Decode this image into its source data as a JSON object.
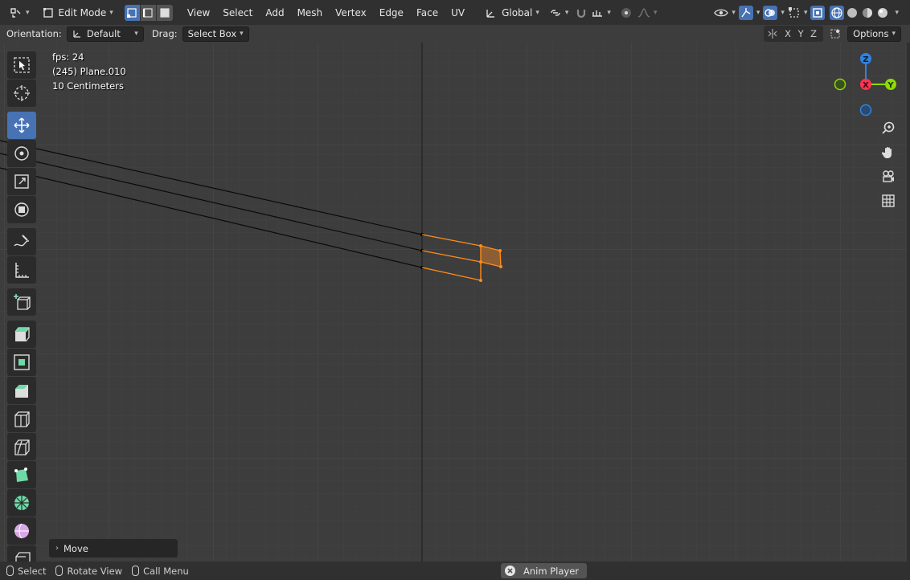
{
  "header": {
    "mode": "Edit Mode",
    "menus": [
      "View",
      "Select",
      "Add",
      "Mesh",
      "Vertex",
      "Edge",
      "Face",
      "UV"
    ],
    "transform_orientation": "Global"
  },
  "tool_options": {
    "orientation_label": "Orientation:",
    "orientation_value": "Default",
    "drag_label": "Drag:",
    "drag_value": "Select Box",
    "axis_x": "X",
    "axis_y": "Y",
    "axis_z": "Z",
    "options_label": "Options"
  },
  "viewport": {
    "fps": "fps: 24",
    "object": "(245) Plane.010",
    "scale": "10 Centimeters"
  },
  "gizmo": {
    "z": "Z",
    "x": "X",
    "y": "Y"
  },
  "last_operator": "Move",
  "statusbar": {
    "select": "Select",
    "rotate": "Rotate View",
    "call_menu": "Call Menu",
    "anim_player": "Anim Player"
  },
  "colors": {
    "accent": "#4772b3",
    "selection": "#ff8c1a",
    "axis_x": "#ff3352",
    "axis_y": "#8bdc00",
    "axis_z": "#2f83e3"
  }
}
